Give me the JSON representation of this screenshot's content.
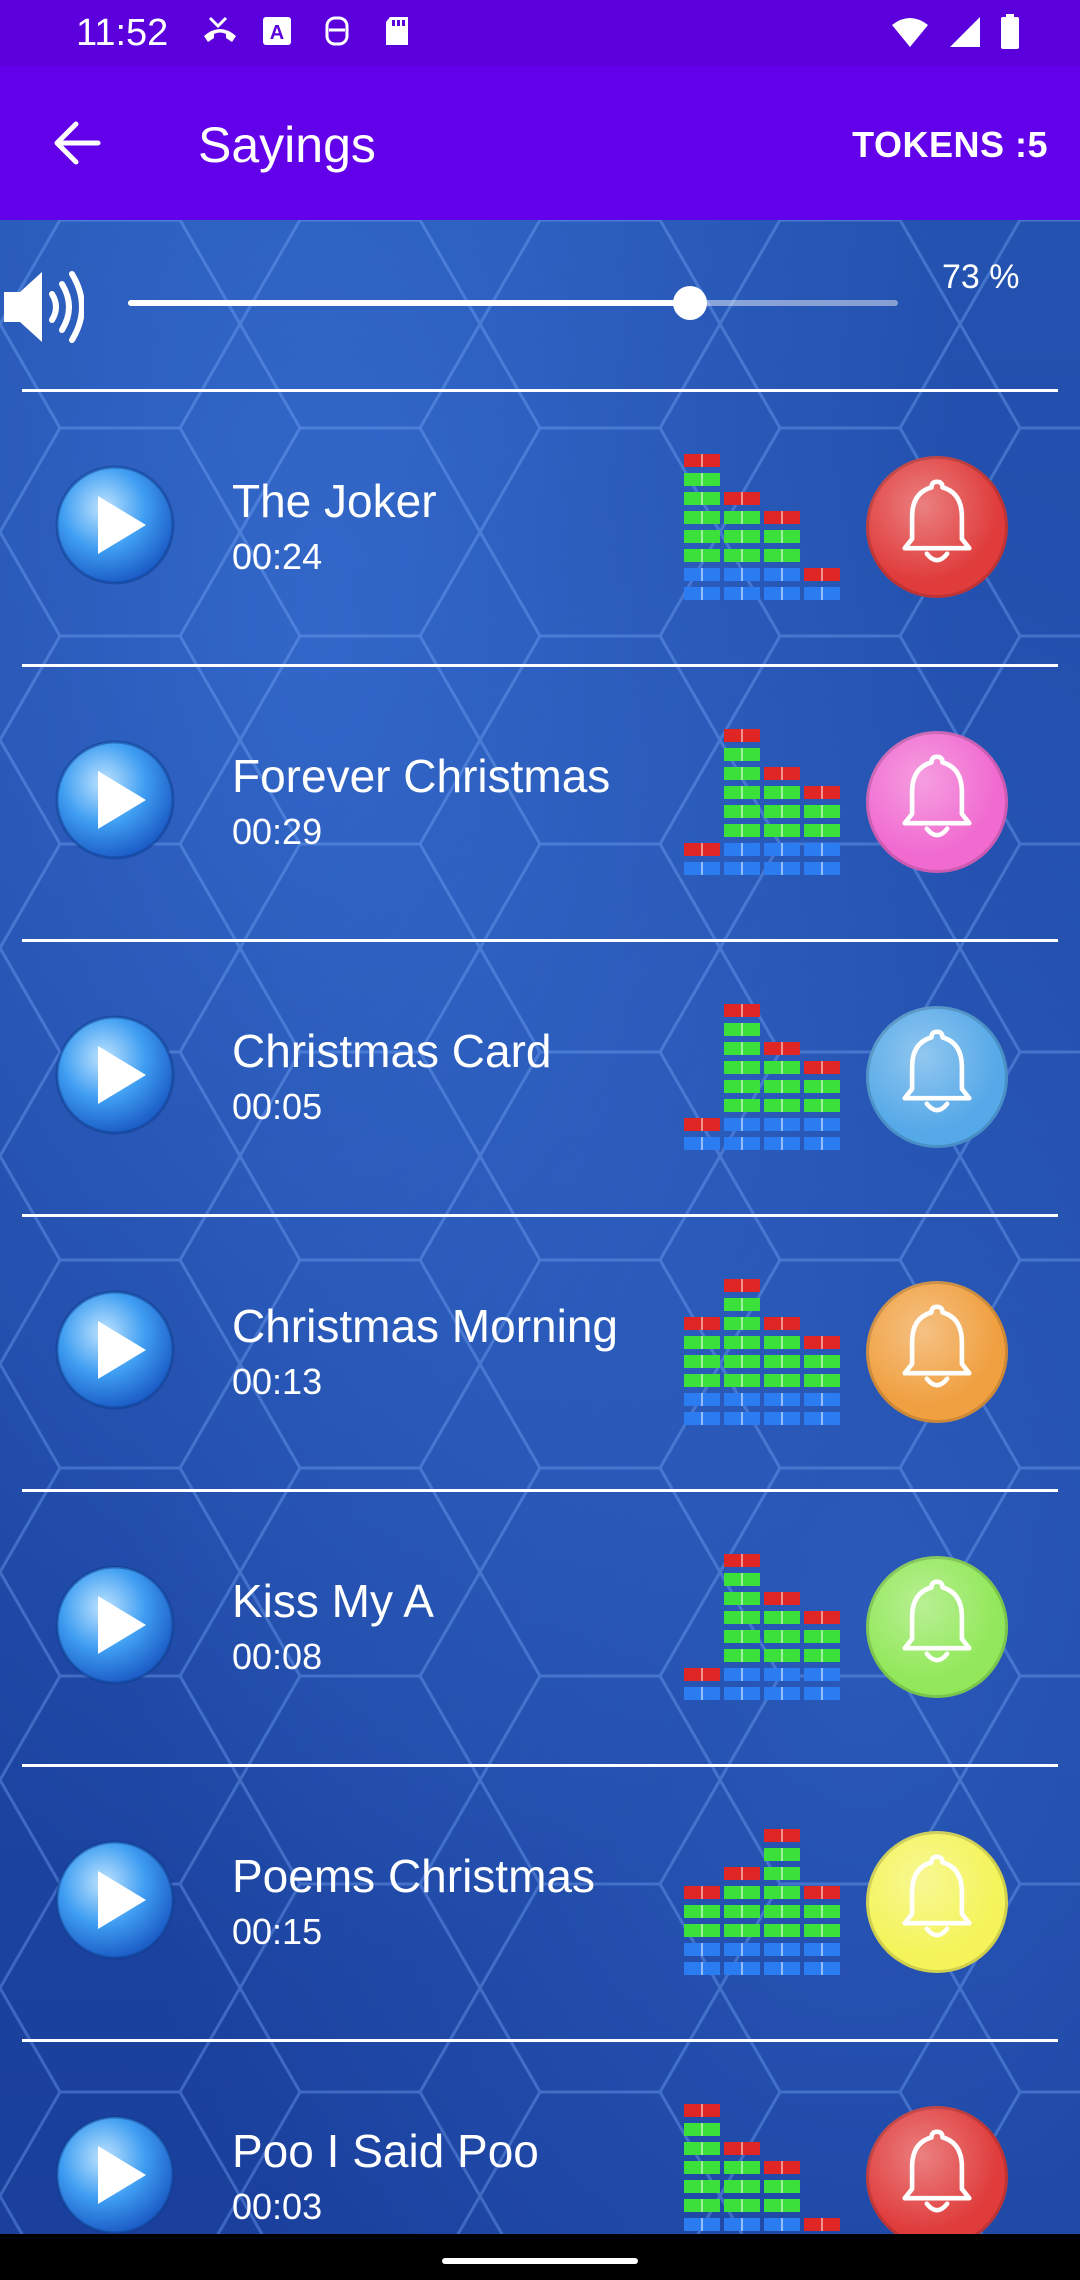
{
  "status_bar": {
    "time": "11:52",
    "left_icons": [
      "missed-call-icon",
      "a-icon",
      "secure-icon",
      "sd-card-icon"
    ],
    "right_icons": [
      "wifi-icon",
      "signal-icon",
      "battery-icon"
    ]
  },
  "app_bar": {
    "title": "Sayings",
    "tokens": "TOKENS :5",
    "back_icon": "arrow-left-icon"
  },
  "volume": {
    "icon": "speaker-icon",
    "percent_label": "73 %",
    "level": 0.73
  },
  "sounds": [
    {
      "title": "The Joker",
      "duration": "00:24",
      "bell_color": "#e03c3c",
      "eq": [
        0,
        2,
        3,
        6
      ]
    },
    {
      "title": "Forever Christmas",
      "duration": "00:29",
      "bell_color": "#f06ad0",
      "eq": [
        6,
        0,
        2,
        3
      ]
    },
    {
      "title": "Christmas Card",
      "duration": "00:05",
      "bell_color": "#56a9e8",
      "eq": [
        6,
        0,
        2,
        3
      ]
    },
    {
      "title": "Christmas Morning",
      "duration": "00:13",
      "bell_color": "#f0a040",
      "eq": [
        null,
        0,
        2,
        3
      ]
    },
    {
      "title": "Kiss My A",
      "duration": "00:08",
      "bell_color": "#92e85a",
      "eq": [
        6,
        0,
        2,
        3
      ]
    },
    {
      "title": "Poems Christmas",
      "duration": "00:15",
      "bell_color": "#f4f45a",
      "eq": [
        3,
        2,
        0,
        3
      ]
    },
    {
      "title": "Poo I Said Poo",
      "duration": "00:03",
      "bell_color": "#e03c3c",
      "eq": [
        0,
        2,
        3,
        6
      ]
    }
  ]
}
